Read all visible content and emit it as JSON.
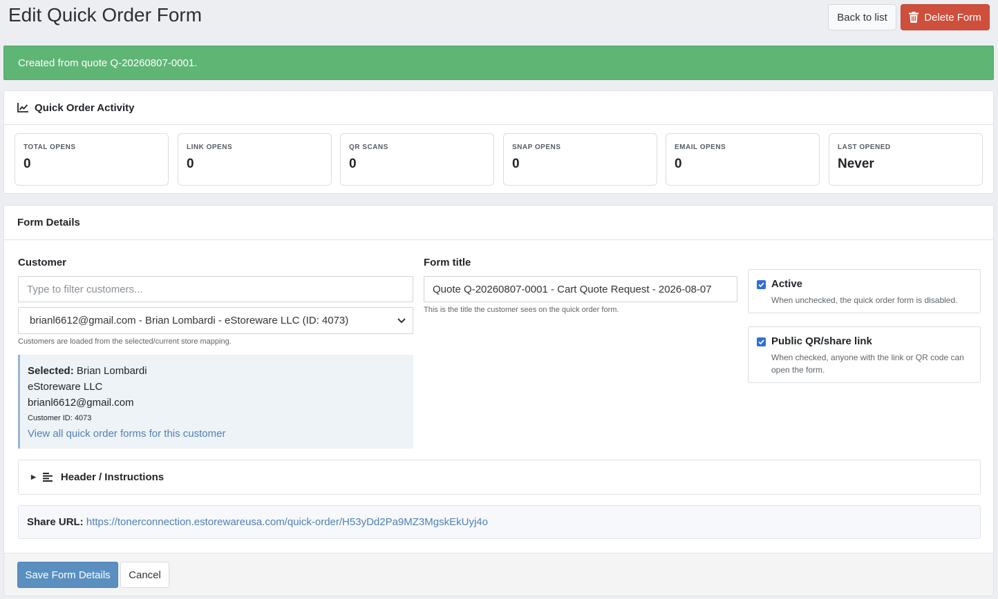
{
  "header": {
    "title": "Edit Quick Order Form",
    "back_label": "Back to list",
    "delete_label": "Delete Form"
  },
  "alert": {
    "message": "Created from quote Q-20260807-0001."
  },
  "activity": {
    "title": "Quick Order Activity",
    "stats": [
      {
        "label": "TOTAL OPENS",
        "value": "0"
      },
      {
        "label": "LINK OPENS",
        "value": "0"
      },
      {
        "label": "QR SCANS",
        "value": "0"
      },
      {
        "label": "SNAP OPENS",
        "value": "0"
      },
      {
        "label": "EMAIL OPENS",
        "value": "0"
      },
      {
        "label": "LAST OPENED",
        "value": "Never"
      }
    ]
  },
  "details": {
    "title": "Form Details",
    "customer": {
      "label": "Customer",
      "filter_placeholder": "Type to filter customers...",
      "selected_option": "brianl6612@gmail.com - Brian Lombardi - eStoreware LLC (ID: 4073)",
      "help": "Customers are loaded from the selected/current store mapping.",
      "selected_label": "Selected:",
      "selected_name": "Brian Lombardi",
      "company": "eStoreware LLC",
      "email": "brianl6612@gmail.com",
      "customer_id": "Customer ID: 4073",
      "view_all_link": "View all quick order forms for this customer"
    },
    "form_title": {
      "label": "Form title",
      "value": "Quote Q-20260807-0001 - Cart Quote Request - 2026-08-07",
      "help": "This is the title the customer sees on the quick order form."
    },
    "active": {
      "checked": true,
      "label": "Active",
      "help": "When unchecked, the quick order form is disabled."
    },
    "public_link": {
      "checked": true,
      "label": "Public QR/share link",
      "help": "When checked, anyone with the link or QR code can open the form."
    },
    "accordion": {
      "label": "Header / Instructions"
    },
    "share": {
      "label": "Share URL:",
      "url": "https://tonerconnection.estorewareusa.com/quick-order/H53yDd2Pa9MZ3MgskEkUyj4o"
    },
    "footer": {
      "save_label": "Save Form Details",
      "cancel_label": "Cancel"
    }
  },
  "colors": {
    "success": "#5fb574",
    "danger": "#cf4f3d",
    "primary": "#5b8fc0",
    "link": "#4f80b6"
  }
}
